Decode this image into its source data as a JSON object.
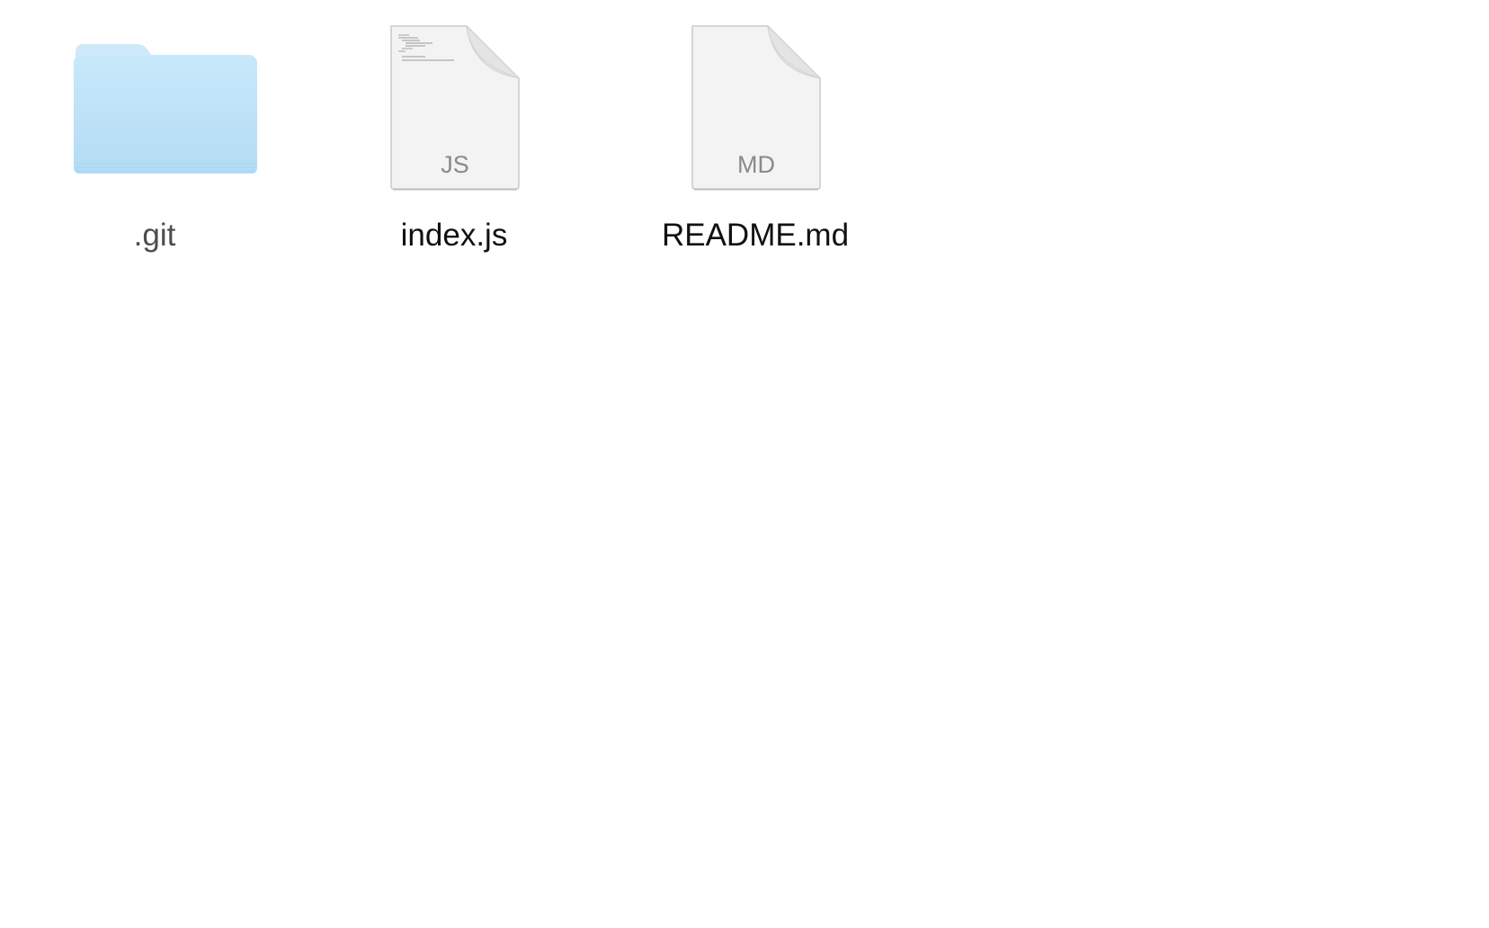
{
  "items": [
    {
      "name": ".git",
      "kind": "folder",
      "icon": "folder-icon",
      "hidden": true
    },
    {
      "name": "index.js",
      "kind": "document",
      "icon": "js-file-icon",
      "extension_badge": "JS"
    },
    {
      "name": "README.md",
      "kind": "document",
      "icon": "md-file-icon",
      "extension_badge": "MD"
    }
  ],
  "colors": {
    "folder_body": "#bfe3f8",
    "folder_tab": "#cde9fa",
    "document_paper": "#f3f3f3",
    "document_fold": "#e6e6e6",
    "badge_text": "#8a8a8a",
    "hidden_name_text": "#4d4d4d",
    "name_text": "#111111"
  }
}
